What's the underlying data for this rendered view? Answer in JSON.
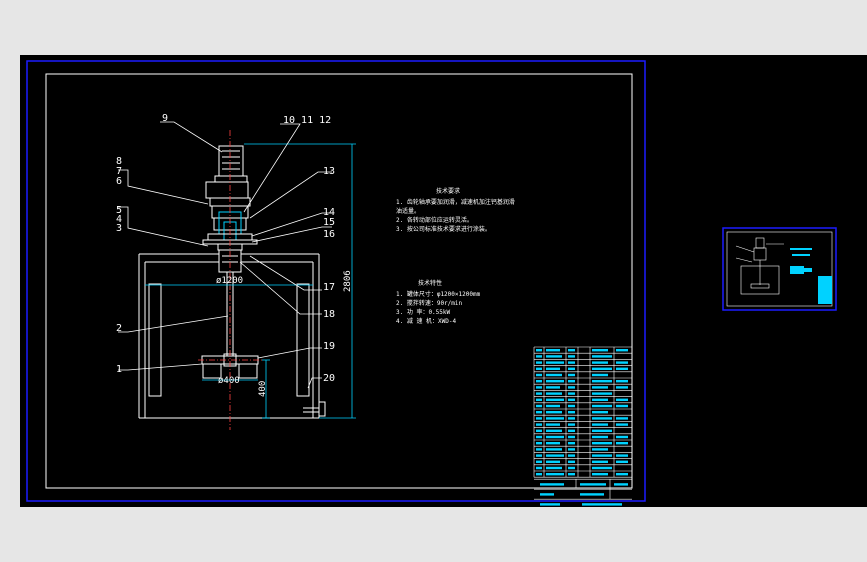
{
  "drawing": {
    "part_labels": [
      "9",
      "10 11 12",
      "8",
      "7",
      "6",
      "13",
      "5",
      "4",
      "3",
      "14",
      "15",
      "16",
      "17",
      "18",
      "2",
      "19",
      "1",
      "20"
    ],
    "dimensions": {
      "tank_diameter": "ø1200",
      "impeller_diameter": "ø400",
      "impeller_height": "400",
      "total_height": "2806"
    },
    "notes_block_1": {
      "title": "技术要求",
      "lines": [
        "1. 齿轮轴承要加润滑，减速机加注钙基润滑",
        "   油适量。",
        "2. 各转动部位应运转灵活。",
        "3. 按公司标准技术要求进行涂装。"
      ]
    },
    "notes_block_2": {
      "title": "技术特性",
      "lines": [
        "1. 罐体尺寸：φ1200×1200mm",
        "2. 搅拌转速：90r/min",
        "3. 功    率：0.55kW",
        "4. 减 速 机：XWD-4"
      ]
    }
  },
  "colors": {
    "background": "#000000",
    "frame": "#ffffff",
    "viewport_border": "#1c1cff",
    "leader": "#ffffff",
    "dimension": "#00d2ff",
    "part": "#ffffff",
    "centerline": "#ff4040",
    "outside": "#e6e6e6"
  }
}
